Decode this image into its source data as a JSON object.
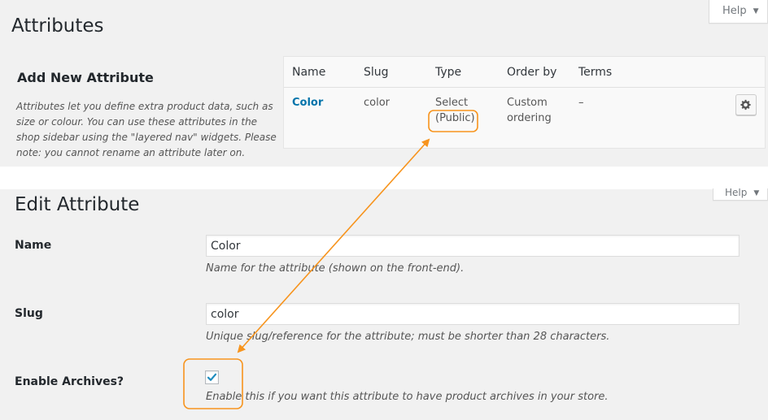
{
  "header": {
    "title": "Attributes",
    "help_label": "Help"
  },
  "add_attribute": {
    "heading": "Add New Attribute",
    "description": "Attributes let you define extra product data, such as size or colour. You can use these attributes in the shop sidebar using the \"layered nav\" widgets. Please note: you cannot rename an attribute later on."
  },
  "table": {
    "columns": [
      "Name",
      "Slug",
      "Type",
      "Order by",
      "Terms"
    ],
    "rows": [
      {
        "name": "Color",
        "slug": "color",
        "type_line1": "Select",
        "type_line2": "(Public)",
        "order_line1": "Custom",
        "order_line2": "ordering",
        "terms": "–"
      }
    ],
    "gear_icon": "gear-icon"
  },
  "edit_attribute": {
    "title": "Edit Attribute",
    "help_label": "Help",
    "name_label": "Name",
    "name_value": "Color",
    "name_desc": "Name for the attribute (shown on the front-end).",
    "slug_label": "Slug",
    "slug_value": "color",
    "slug_desc": "Unique slug/reference for the attribute; must be shorter than 28 characters.",
    "archives_label": "Enable Archives?",
    "archives_checked": true,
    "archives_desc": "Enable this if you want this attribute to have product archives in your store."
  },
  "colors": {
    "annotation": "#f7941d",
    "link": "#0073aa",
    "check": "#1e8cbe"
  }
}
